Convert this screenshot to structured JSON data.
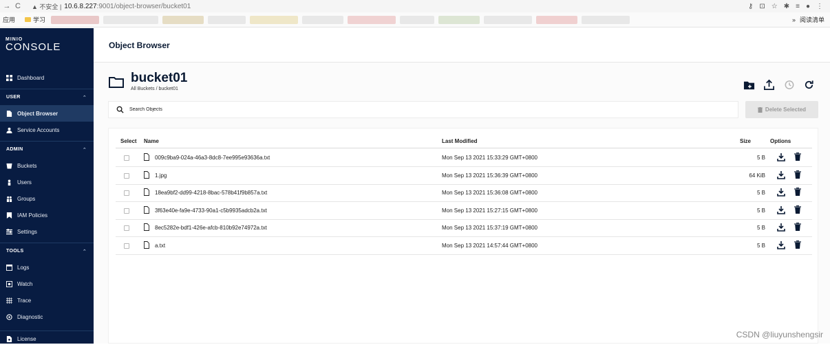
{
  "browser": {
    "insecure_label": "不安全",
    "url_host": "10.6.8.227",
    "url_path": ":9001/object-browser/bucket01",
    "apps_label": "应用",
    "bookmark_folder": "学习",
    "reading_list": "阅读清单"
  },
  "logo": {
    "small": "MINIO",
    "big": "CONSOLE"
  },
  "sidebar": {
    "dashboard": "Dashboard",
    "user_section": "USER",
    "object_browser": "Object Browser",
    "service_accounts": "Service Accounts",
    "admin_section": "ADMIN",
    "buckets": "Buckets",
    "users": "Users",
    "groups": "Groups",
    "iam_policies": "IAM Policies",
    "settings": "Settings",
    "tools_section": "TOOLS",
    "logs": "Logs",
    "watch": "Watch",
    "trace": "Trace",
    "diagnostic": "Diagnostic",
    "license": "License"
  },
  "page_title": "Object Browser",
  "bucket": {
    "name": "bucket01",
    "breadcrumb": "All Buckets / bucket01"
  },
  "search": {
    "placeholder": "Search Objects"
  },
  "delete_selected": "Delete Selected",
  "table": {
    "headers": {
      "select": "Select",
      "name": "Name",
      "last_modified": "Last Modified",
      "size": "Size",
      "options": "Options"
    },
    "rows": [
      {
        "name": "009c9ba9-024a-46a3-8dc8-7ee995e93636a.txt",
        "modified": "Mon Sep 13 2021 15:33:29 GMT+0800",
        "size": "5 B"
      },
      {
        "name": "1.jpg",
        "modified": "Mon Sep 13 2021 15:36:39 GMT+0800",
        "size": "64 KiB"
      },
      {
        "name": "18ea9bf2-dd99-4218-8bac-578b41f9b857a.txt",
        "modified": "Mon Sep 13 2021 15:36:08 GMT+0800",
        "size": "5 B"
      },
      {
        "name": "3f63e40e-fa9e-4733-90a1-c5b9935adcb2a.txt",
        "modified": "Mon Sep 13 2021 15:27:15 GMT+0800",
        "size": "5 B"
      },
      {
        "name": "8ec5282e-bdf1-426e-afcb-810b92e74972a.txt",
        "modified": "Mon Sep 13 2021 15:37:19 GMT+0800",
        "size": "5 B"
      },
      {
        "name": "a.txt",
        "modified": "Mon Sep 13 2021 14:57:44 GMT+0800",
        "size": "5 B"
      }
    ]
  },
  "watermark": "CSDN @liuyunshengsir",
  "colors": {
    "sidebar_bg": "#081c42",
    "sidebar_active": "#1f3a63",
    "accent_text": "#0a1a33"
  },
  "icons": [
    "back-icon",
    "reload-icon",
    "folder-icon",
    "new-folder-icon",
    "upload-icon",
    "history-icon",
    "refresh-icon",
    "search-icon",
    "trash-icon",
    "download-icon",
    "file-icon"
  ]
}
